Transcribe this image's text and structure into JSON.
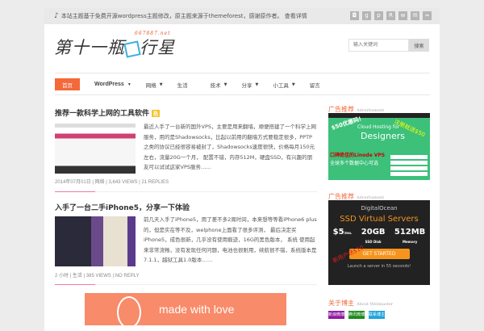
{
  "topbar": {
    "notice": "本站主题基于免费开源wordpress主题修改，原主题来源于themeforest，感谢原作者。 查看详情",
    "social_icons": [
      "instagram-icon",
      "google-plus-icon",
      "pinterest-icon",
      "renren-icon",
      "weibo-icon",
      "mail-icon",
      "rss-icon"
    ]
  },
  "header": {
    "logo_text": "第十一瓶",
    "logo_text2": "行星",
    "logo_domain": "667887.net",
    "search_placeholder": "输入关键词",
    "search_button": "搜索"
  },
  "nav": [
    {
      "label": "首页",
      "active": true
    },
    {
      "label": "WordPress",
      "caret": true
    },
    {
      "label": "网络",
      "caret": true
    },
    {
      "label": "生活"
    },
    {
      "label": "技术",
      "caret": true
    },
    {
      "label": "分享",
      "caret": true
    },
    {
      "label": "小工具",
      "caret": true
    },
    {
      "label": "留言"
    }
  ],
  "posts": [
    {
      "title": "推荐一款科学上网的工具软件",
      "badge": "热",
      "excerpt": "最近入手了一台新的国外VPS，主要是用来翻墙，顺便搭建了一个科学上网服务，用的是Shadowsocks，比起以前用的翻墙方式要稳定很多，PPTP之类的协议已经很容易被封了，Shadowsocks速度很快，价格每月150元左右，流量20G一个月， 配置不错，内存512M，硬盘SSD，有兴趣的朋友可以试试这家VPS服务……",
      "meta": "2014年07月01日 | 网络 | 3,643 VIEWS | 21 REPLIES"
    },
    {
      "title": "入手了一台二手iPhone5，分享一下体验",
      "excerpt": "前几天入手了iPhone5，用了差不多2周时间，本来想等等看iPhone6 plus的，但是实在等不及，welphone上面看了很多评测， 最后决定买iPhone5，成色很新，几乎没有使用痕迹，16G的黑色版本， 系统 使用起来非常流畅，没有发现任何问题，电池也很耐用，续航很不错，系统版本是 7.1.1，越狱工具1.0版本……",
      "meta": "2 小时 | 生活 | 385 VIEWS | NO REPLY"
    }
  ],
  "banner": {
    "text": "made with love"
  },
  "sidebar": {
    "ad_heading": "广告推荐",
    "ad_heading_en": "Advertisment",
    "linode": {
      "title": "Cloud Hosting for",
      "big": "Designers",
      "promo1": "$50优惠码!",
      "promo2": "注册就送$50",
      "line1": "口碑绝佳的Linode VPS",
      "line2": "全球多个数据中心可选"
    },
    "digitalocean": {
      "brand": "DigitalOcean",
      "title": "SSD Virtual Servers",
      "price": "$5",
      "price_unit": "/mo.",
      "disk": "20GB",
      "disk_label": "SSD Disk",
      "mem": "512MB",
      "mem_label": "Memory",
      "cta": "GET STARTED",
      "promo": "新用户送$10",
      "footer": "Launch a server in 55 seconds!"
    },
    "about_heading": "关于博主",
    "about_heading_en": "About Webmaster",
    "tags": [
      {
        "label": "新浪微博",
        "color": "#8e1a9e"
      },
      {
        "label": "腾讯微博",
        "color": "#1d8a1d"
      },
      {
        "label": "联系博主",
        "color": "#1fa3dd"
      }
    ]
  }
}
